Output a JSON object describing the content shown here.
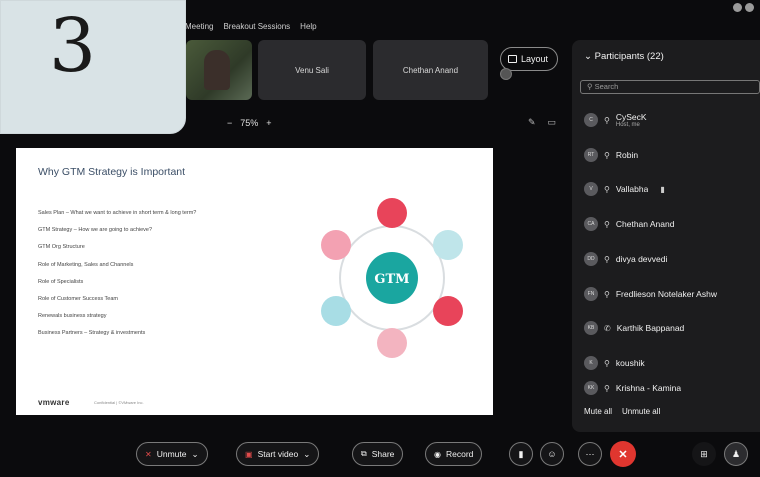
{
  "badge_number": "3",
  "menu": [
    "Meeting",
    "Breakout Sessions",
    "Help"
  ],
  "tiles": [
    "Venu Sali",
    "Chethan Anand"
  ],
  "layout_label": "Layout",
  "zoom_level": "75%",
  "slide": {
    "title": "Why GTM Strategy is Important",
    "bullets": [
      "Sales Plan – What we want to achieve in short term & long term?",
      "GTM Strategy – How we are going to achieve?",
      "GTM Org Structure",
      "Role of Marketing, Sales and Channels",
      "Role of Specialists",
      "Role of Customer Success Team",
      "Renewals business strategy",
      "Business Partners – Strategy & investments"
    ],
    "hub_label": "GTM",
    "logo": "vmware",
    "footnote": "Confidential | ©VMware Inc."
  },
  "participants": {
    "header": "Participants (22)",
    "search_placeholder": "Search",
    "rows": [
      {
        "initials": "C",
        "name": "CySecK",
        "role": "Host, me"
      },
      {
        "initials": "RT",
        "name": "Robin",
        "role": ""
      },
      {
        "initials": "V",
        "name": "Vallabha",
        "role": ""
      },
      {
        "initials": "CA",
        "name": "Chethan Anand",
        "role": ""
      },
      {
        "initials": "DD",
        "name": "divya devvedi",
        "role": ""
      },
      {
        "initials": "FN",
        "name": "Fredlieson Notelaker Ashw",
        "role": ""
      },
      {
        "initials": "KB",
        "name": "Karthik Bappanad",
        "role": ""
      },
      {
        "initials": "K",
        "name": "koushik",
        "role": ""
      },
      {
        "initials": "KK",
        "name": "Krishna - Kamina",
        "role": ""
      }
    ],
    "mute_all": "Mute all",
    "unmute_all": "Unmute all"
  },
  "controls": {
    "unmute": "Unmute",
    "start_video": "Start video",
    "share": "Share",
    "record": "Record"
  }
}
